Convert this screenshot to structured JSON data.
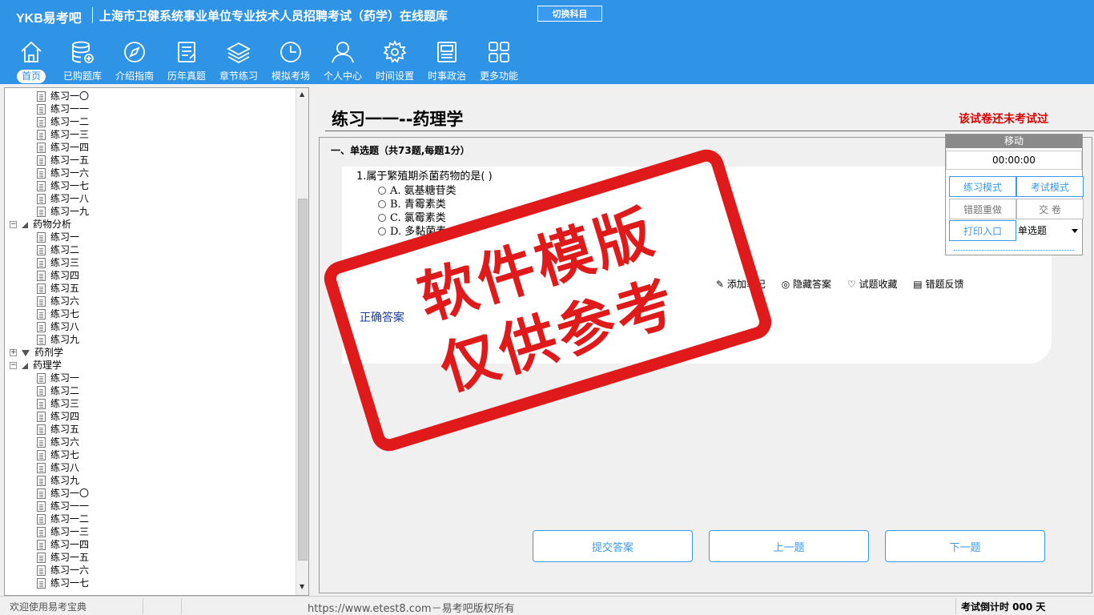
{
  "header": {
    "brand": "YKB易考吧",
    "title": "上海市卫健系统事业单位专业技术人员招聘考试（药学）在线题库",
    "switch_subject": "切换科目"
  },
  "nav": {
    "items": [
      {
        "label": "首页",
        "icon": "home-icon",
        "active": true
      },
      {
        "label": "已购题库",
        "icon": "database-add-icon"
      },
      {
        "label": "介绍指南",
        "icon": "compass-icon"
      },
      {
        "label": "历年真题",
        "icon": "document-list-icon"
      },
      {
        "label": "章节练习",
        "icon": "layers-icon"
      },
      {
        "label": "模拟考场",
        "icon": "clock-icon"
      },
      {
        "label": "个人中心",
        "icon": "user-icon"
      },
      {
        "label": "时间设置",
        "icon": "gear-icon"
      },
      {
        "label": "时事政治",
        "icon": "news-icon"
      },
      {
        "label": "更多功能",
        "icon": "grid-icon"
      }
    ]
  },
  "tree": {
    "nodes": [
      {
        "label": "练习一〇",
        "type": "doc",
        "level": 2
      },
      {
        "label": "练习一一",
        "type": "doc",
        "level": 2
      },
      {
        "label": "练习一二",
        "type": "doc",
        "level": 2
      },
      {
        "label": "练习一三",
        "type": "doc",
        "level": 2
      },
      {
        "label": "练习一四",
        "type": "doc",
        "level": 2
      },
      {
        "label": "练习一五",
        "type": "doc",
        "level": 2
      },
      {
        "label": "练习一六",
        "type": "doc",
        "level": 2
      },
      {
        "label": "练习一七",
        "type": "doc",
        "level": 2
      },
      {
        "label": "练习一八",
        "type": "doc",
        "level": 2
      },
      {
        "label": "练习一九",
        "type": "doc",
        "level": 2
      },
      {
        "label": "药物分析",
        "type": "folder",
        "expanded": true,
        "level": 1
      },
      {
        "label": "练习一",
        "type": "doc",
        "level": 2
      },
      {
        "label": "练习二",
        "type": "doc",
        "level": 2
      },
      {
        "label": "练习三",
        "type": "doc",
        "level": 2
      },
      {
        "label": "练习四",
        "type": "doc",
        "level": 2
      },
      {
        "label": "练习五",
        "type": "doc",
        "level": 2
      },
      {
        "label": "练习六",
        "type": "doc",
        "level": 2
      },
      {
        "label": "练习七",
        "type": "doc",
        "level": 2
      },
      {
        "label": "练习八",
        "type": "doc",
        "level": 2
      },
      {
        "label": "练习九",
        "type": "doc",
        "level": 2
      },
      {
        "label": "药剂学",
        "type": "folder",
        "expanded": false,
        "level": 1
      },
      {
        "label": "药理学",
        "type": "folder",
        "expanded": true,
        "level": 1
      },
      {
        "label": "练习一",
        "type": "doc",
        "level": 2
      },
      {
        "label": "练习二",
        "type": "doc",
        "level": 2
      },
      {
        "label": "练习三",
        "type": "doc",
        "level": 2
      },
      {
        "label": "练习四",
        "type": "doc",
        "level": 2
      },
      {
        "label": "练习五",
        "type": "doc",
        "level": 2
      },
      {
        "label": "练习六",
        "type": "doc",
        "level": 2
      },
      {
        "label": "练习七",
        "type": "doc",
        "level": 2
      },
      {
        "label": "练习八",
        "type": "doc",
        "level": 2
      },
      {
        "label": "练习九",
        "type": "doc",
        "level": 2
      },
      {
        "label": "练习一〇",
        "type": "doc",
        "level": 2
      },
      {
        "label": "练习一一",
        "type": "doc",
        "level": 2,
        "current": true
      },
      {
        "label": "练习一二",
        "type": "doc",
        "level": 2
      },
      {
        "label": "练习一三",
        "type": "doc",
        "level": 2
      },
      {
        "label": "练习一四",
        "type": "doc",
        "level": 2
      },
      {
        "label": "练习一五",
        "type": "doc",
        "level": 2
      },
      {
        "label": "练习一六",
        "type": "doc",
        "level": 2
      },
      {
        "label": "练习一七",
        "type": "doc",
        "level": 2
      }
    ]
  },
  "exam": {
    "title": "练习一一--药理学",
    "status": "该试卷还未考试过",
    "section_heading": "一、单选题（共73题,每题1分）",
    "question": "1.属于繁殖期杀菌药物的是( )",
    "options": [
      "A. 氨基糖苷类",
      "B. 青霉素类",
      "C. 氯霉素类",
      "D. 多黏菌素"
    ],
    "tools": [
      "添加笔记",
      "隐藏答案",
      "试题收藏",
      "错题反馈"
    ],
    "correct_answer_label": "正确答案",
    "buttons": {
      "submit": "提交答案",
      "prev": "上一题",
      "next": "下一题"
    }
  },
  "control_panel": {
    "move_label": "移动",
    "timer": "00:00:00",
    "practice_mode": "练习模式",
    "exam_mode": "考试模式",
    "redo_wrong": "错题重做",
    "hand_in": "交 卷",
    "print_entry": "打印入口",
    "question_type": "单选题"
  },
  "watermark": {
    "line1": "软件模版",
    "line2": "仅供参考"
  },
  "status_bar": {
    "welcome": "欢迎使用易考宝典",
    "copyright": "https://www.etest8.com－易考吧版权所有",
    "countdown": "考试倒计时 000 天"
  },
  "colors": {
    "header_bg": "#2f93e6",
    "accent": "#3a9af0",
    "warning": "#dd0000",
    "stamp": "#e01a1a"
  }
}
